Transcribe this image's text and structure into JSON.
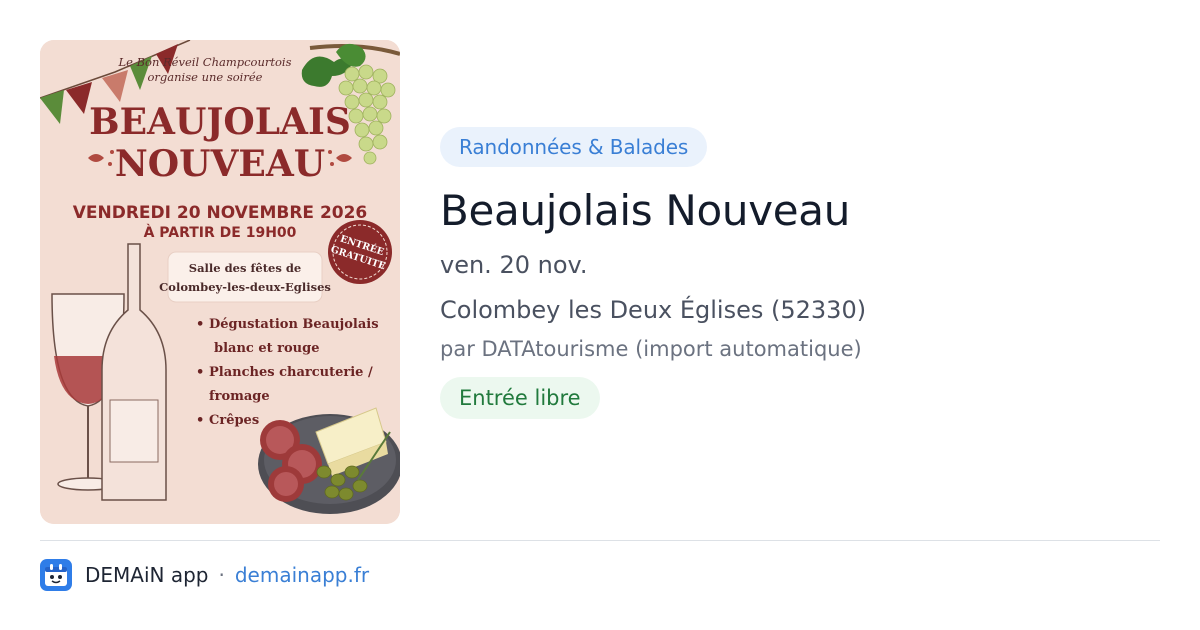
{
  "poster": {
    "organizer_line1": "Le Bon Réveil Champcourtois",
    "organizer_line2": "organise une soirée",
    "headline1": "BEAUJOLAIS",
    "headline2": "NOUVEAU",
    "date": "VENDREDI 20 NOVEMBRE 2026",
    "time": "À PARTIR DE 19H00",
    "badge_line1": "ENTRÉE",
    "badge_line2": "GRATUITE",
    "venue_line1": "Salle des fêtes de",
    "venue_line2": "Colombey-les-deux-Eglises",
    "bullets": [
      [
        "Dégustation Beaujolais",
        "blanc et rouge"
      ],
      [
        "Planches charcuterie /",
        "fromage"
      ],
      [
        "Crêpes"
      ]
    ]
  },
  "event": {
    "category": "Randonnées & Balades",
    "title": "Beaujolais Nouveau",
    "date": "ven. 20 nov.",
    "location": "Colombey les Deux Églises (52330)",
    "source": "par DATAtourisme (import automatique)",
    "price": "Entrée libre"
  },
  "footer": {
    "app_name": "DEMAiN app",
    "separator": "·",
    "url": "demainapp.fr"
  },
  "colors": {
    "accent": "#3a7fd5",
    "poster_title": "#8b2a2a",
    "price_green": "#217a3d",
    "logo_blue": "#2f7de8"
  }
}
